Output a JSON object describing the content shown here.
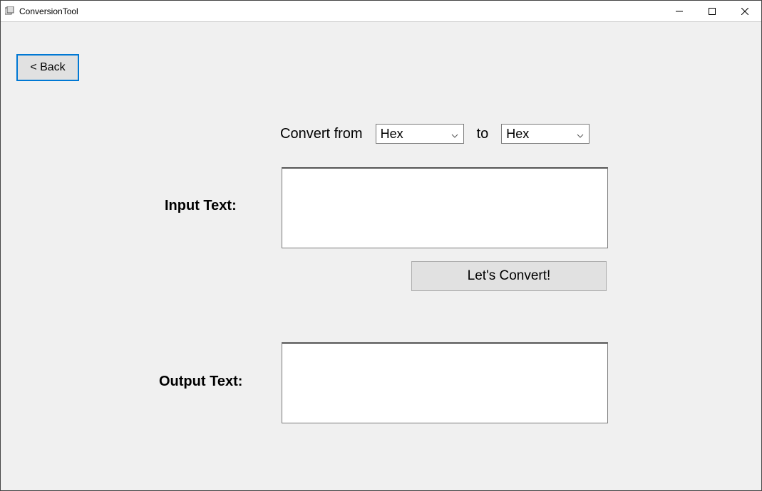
{
  "title": "ConversionTool",
  "back_button": "< Back",
  "convert_from_label": "Convert from",
  "to_label": "to",
  "dropdown_from": "Hex",
  "dropdown_to": "Hex",
  "input_label": "Input Text:",
  "output_label": "Output Text:",
  "input_value": "",
  "output_value": "",
  "convert_button": "Let's Convert!"
}
